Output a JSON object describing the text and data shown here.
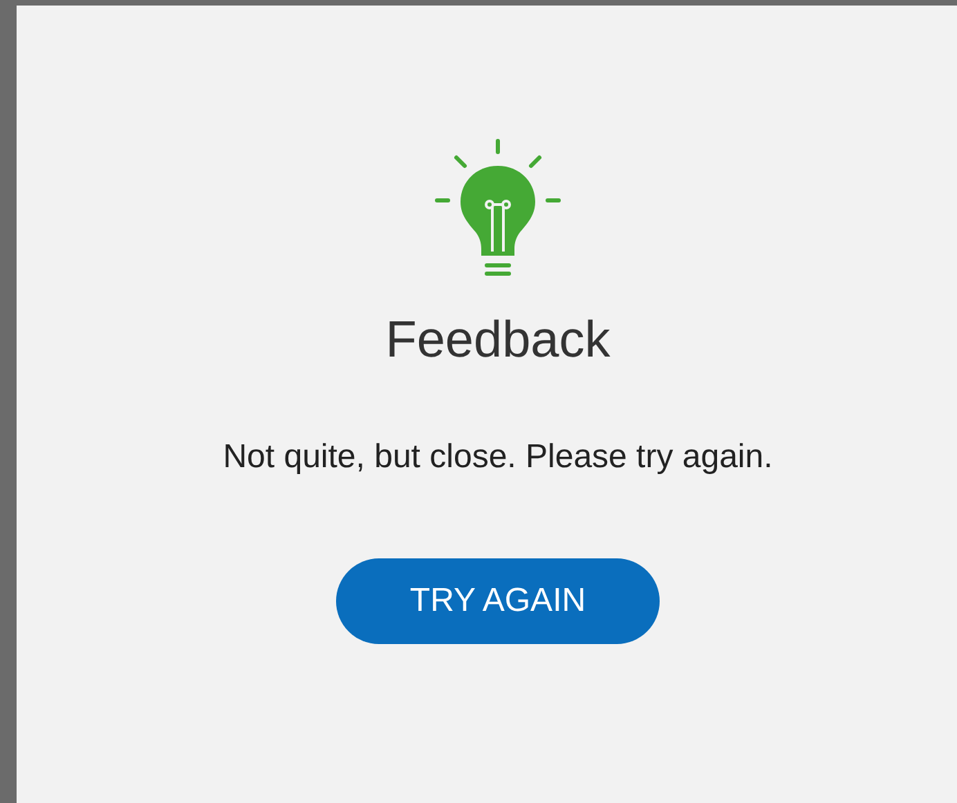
{
  "dialog": {
    "title": "Feedback",
    "message": "Not quite, but close. Please try again.",
    "button": "TRY AGAIN"
  }
}
